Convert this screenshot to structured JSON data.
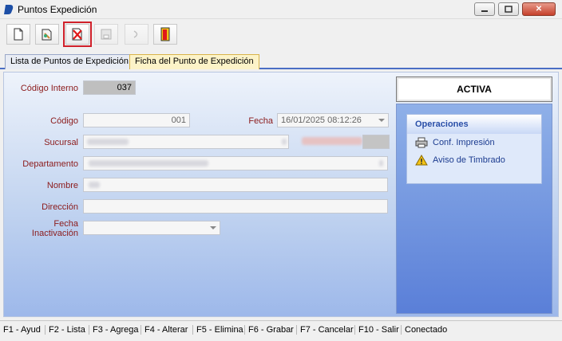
{
  "window": {
    "title": "Puntos Expedición",
    "minimize_label": "▭",
    "maximize_label": "▢",
    "close_label": "✕"
  },
  "toolbar": {
    "buttons": [
      {
        "name": "new-document-icon",
        "enabled": true
      },
      {
        "name": "edit-document-icon",
        "enabled": true
      },
      {
        "name": "delete-document-icon",
        "enabled": true,
        "highlighted": true
      },
      {
        "name": "save-disk-icon",
        "enabled": false
      },
      {
        "name": "undo-icon",
        "enabled": false
      },
      {
        "name": "exit-door-icon",
        "enabled": true
      }
    ]
  },
  "tabs": [
    {
      "label": "Lista de Puntos de Expedición",
      "active": false
    },
    {
      "label": "Ficha del Punto de Expedición",
      "active": true
    }
  ],
  "form": {
    "codigo_interno_label": "Código Interno",
    "codigo_interno_value": "037",
    "codigo_label": "Código",
    "codigo_value": "001",
    "fecha_label": "Fecha",
    "fecha_value": "16/01/2025 08:12:26",
    "sucursal_label": "Sucursal",
    "departamento_label": "Departamento",
    "nombre_label": "Nombre",
    "direccion_label": "Dirección",
    "direccion_value": "",
    "fecha_inactivacion_label": "Fecha Inactivación",
    "fecha_inactivacion_value": ""
  },
  "status_box": {
    "text": "ACTIVA"
  },
  "operaciones": {
    "title": "Operaciones",
    "items": [
      {
        "label": "Conf. Impresión",
        "icon": "printer-icon"
      },
      {
        "label": "Aviso de Timbrado",
        "icon": "warning-icon"
      }
    ]
  },
  "statusbar": {
    "keys": [
      "F1 - Ayud",
      "F2 - Lista",
      "F3 - Agrega",
      "F4 - Alterar",
      "F5 - Elimina",
      "F6 - Grabar",
      "F7 - Cancelar",
      "F10 - Salir"
    ],
    "connection": "Conectado"
  },
  "colors": {
    "label_red": "#8b1a1a",
    "panel_blue": "#5a7fd8",
    "active_tab": "#fcf3c8",
    "highlight_red": "#d0202a"
  }
}
